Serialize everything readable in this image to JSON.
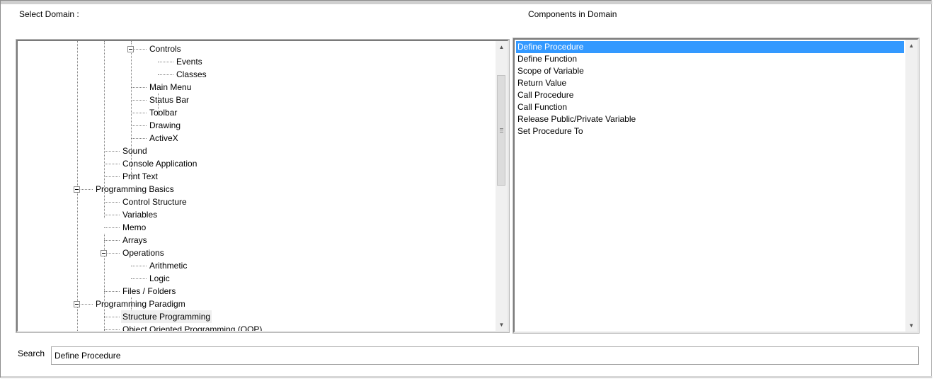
{
  "labels": {
    "select_domain": "Select Domain :",
    "components": "Components in Domain",
    "search": "Search"
  },
  "tree": {
    "items": [
      {
        "label": "Controls",
        "level": 3,
        "expanded": true
      },
      {
        "label": "Events",
        "level": 4
      },
      {
        "label": "Classes",
        "level": 4
      },
      {
        "label": "Main Menu",
        "level": 3
      },
      {
        "label": "Status Bar",
        "level": 3
      },
      {
        "label": "Toolbar",
        "level": 3
      },
      {
        "label": "Drawing",
        "level": 3
      },
      {
        "label": "ActiveX",
        "level": 3
      },
      {
        "label": "Sound",
        "level": 2
      },
      {
        "label": "Console Application",
        "level": 2
      },
      {
        "label": "Print Text",
        "level": 2
      },
      {
        "label": "Programming Basics",
        "level": 1,
        "expanded": true
      },
      {
        "label": "Control Structure",
        "level": 2
      },
      {
        "label": "Variables",
        "level": 2
      },
      {
        "label": "Memo",
        "level": 2
      },
      {
        "label": "Arrays",
        "level": 2
      },
      {
        "label": "Operations",
        "level": 2,
        "expanded": true
      },
      {
        "label": "Arithmetic",
        "level": 3
      },
      {
        "label": "Logic",
        "level": 3
      },
      {
        "label": "Files / Folders",
        "level": 2
      },
      {
        "label": "Programming Paradigm",
        "level": 1,
        "expanded": true
      },
      {
        "label": "Structure Programming",
        "level": 2,
        "selected": true
      },
      {
        "label": "Object Oriented Programming (OOP)",
        "level": 2
      }
    ]
  },
  "components": {
    "items": [
      "Define Procedure",
      "Define Function",
      "Scope of Variable",
      "Return Value",
      "Call Procedure",
      "Call Function",
      "Release Public/Private Variable",
      "Set Procedure To"
    ],
    "selected_index": 0
  },
  "search": {
    "value": "Define Procedure"
  },
  "colors": {
    "selection": "#3399ff",
    "tree_selection": "#efefef"
  }
}
